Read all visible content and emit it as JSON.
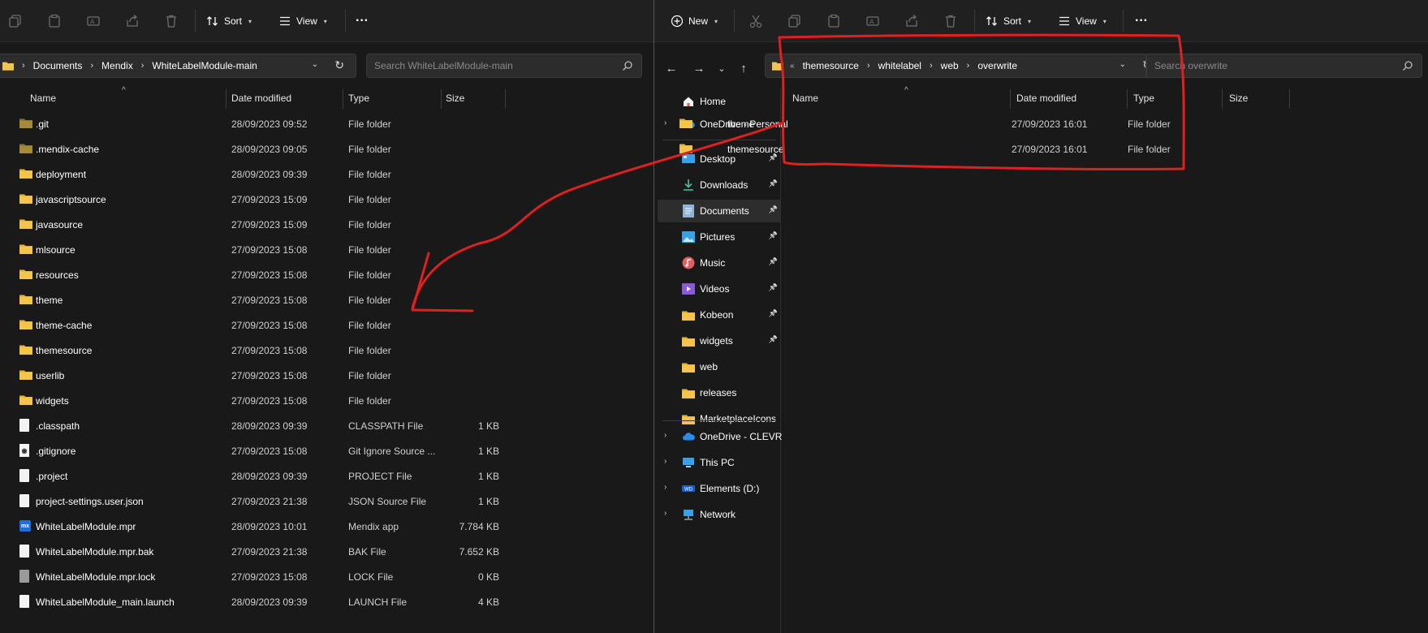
{
  "left": {
    "toolbar": {
      "sort_label": "Sort",
      "view_label": "View",
      "more_label": "···"
    },
    "breadcrumb": [
      "Documents",
      "Mendix",
      "WhiteLabelModule-main"
    ],
    "search_placeholder": "Search WhiteLabelModule-main",
    "columns": {
      "name": "Name",
      "date": "Date modified",
      "type": "Type",
      "size": "Size"
    },
    "files": [
      {
        "name": ".git",
        "date": "28/09/2023 09:52",
        "type": "File folder",
        "size": "",
        "icon": "folder-dark"
      },
      {
        "name": ".mendix-cache",
        "date": "28/09/2023 09:05",
        "type": "File folder",
        "size": "",
        "icon": "folder-dark"
      },
      {
        "name": "deployment",
        "date": "28/09/2023 09:39",
        "type": "File folder",
        "size": "",
        "icon": "folder"
      },
      {
        "name": "javascriptsource",
        "date": "27/09/2023 15:09",
        "type": "File folder",
        "size": "",
        "icon": "folder"
      },
      {
        "name": "javasource",
        "date": "27/09/2023 15:09",
        "type": "File folder",
        "size": "",
        "icon": "folder"
      },
      {
        "name": "mlsource",
        "date": "27/09/2023 15:08",
        "type": "File folder",
        "size": "",
        "icon": "folder"
      },
      {
        "name": "resources",
        "date": "27/09/2023 15:08",
        "type": "File folder",
        "size": "",
        "icon": "folder"
      },
      {
        "name": "theme",
        "date": "27/09/2023 15:08",
        "type": "File folder",
        "size": "",
        "icon": "folder"
      },
      {
        "name": "theme-cache",
        "date": "27/09/2023 15:08",
        "type": "File folder",
        "size": "",
        "icon": "folder"
      },
      {
        "name": "themesource",
        "date": "27/09/2023 15:08",
        "type": "File folder",
        "size": "",
        "icon": "folder"
      },
      {
        "name": "userlib",
        "date": "27/09/2023 15:08",
        "type": "File folder",
        "size": "",
        "icon": "folder"
      },
      {
        "name": "widgets",
        "date": "27/09/2023 15:08",
        "type": "File folder",
        "size": "",
        "icon": "folder"
      },
      {
        "name": ".classpath",
        "date": "28/09/2023 09:39",
        "type": "CLASSPATH File",
        "size": "1 KB",
        "icon": "doc"
      },
      {
        "name": ".gitignore",
        "date": "27/09/2023 15:08",
        "type": "Git Ignore Source ...",
        "size": "1 KB",
        "icon": "git"
      },
      {
        "name": ".project",
        "date": "28/09/2023 09:39",
        "type": "PROJECT File",
        "size": "1 KB",
        "icon": "doc"
      },
      {
        "name": "project-settings.user.json",
        "date": "27/09/2023 21:38",
        "type": "JSON Source File",
        "size": "1 KB",
        "icon": "doc"
      },
      {
        "name": "WhiteLabelModule.mpr",
        "date": "28/09/2023 10:01",
        "type": "Mendix app",
        "size": "7.784 KB",
        "icon": "mx"
      },
      {
        "name": "WhiteLabelModule.mpr.bak",
        "date": "27/09/2023 21:38",
        "type": "BAK File",
        "size": "7.652 KB",
        "icon": "doc"
      },
      {
        "name": "WhiteLabelModule.mpr.lock",
        "date": "27/09/2023 15:08",
        "type": "LOCK File",
        "size": "0 KB",
        "icon": "doc-gray"
      },
      {
        "name": "WhiteLabelModule_main.launch",
        "date": "28/09/2023 09:39",
        "type": "LAUNCH File",
        "size": "4 KB",
        "icon": "doc"
      }
    ]
  },
  "right": {
    "toolbar": {
      "new_label": "New",
      "sort_label": "Sort",
      "view_label": "View",
      "more_label": "···"
    },
    "breadcrumb_overflow": "«",
    "breadcrumb": [
      "themesource",
      "whitelabel",
      "web",
      "overwrite"
    ],
    "search_placeholder": "Search overwrite",
    "columns": {
      "name": "Name",
      "date": "Date modified",
      "type": "Type",
      "size": "Size"
    },
    "files": [
      {
        "name": "theme",
        "date": "27/09/2023 16:01",
        "type": "File folder",
        "icon": "folder"
      },
      {
        "name": "themesource",
        "date": "27/09/2023 16:01",
        "type": "File folder",
        "icon": "folder"
      }
    ],
    "nav": {
      "home": "Home",
      "onedrive_personal": "OneDrive - Personal",
      "quick_access": [
        {
          "label": "Desktop",
          "icon": "desktop-icon",
          "pinned": true
        },
        {
          "label": "Downloads",
          "icon": "downloads-icon",
          "pinned": true
        },
        {
          "label": "Documents",
          "icon": "documents-icon",
          "pinned": true,
          "selected": true
        },
        {
          "label": "Pictures",
          "icon": "pictures-icon",
          "pinned": true
        },
        {
          "label": "Music",
          "icon": "music-icon",
          "pinned": true
        },
        {
          "label": "Videos",
          "icon": "videos-icon",
          "pinned": true
        },
        {
          "label": "Kobeon",
          "icon": "folder-icon",
          "pinned": true
        },
        {
          "label": "widgets",
          "icon": "folder-icon",
          "pinned": true
        },
        {
          "label": "web",
          "icon": "folder-icon",
          "pinned": false
        },
        {
          "label": "releases",
          "icon": "folder-icon",
          "pinned": false
        },
        {
          "label": "MarketplaceIcons",
          "icon": "folder-icon",
          "pinned": false
        }
      ],
      "onedrive_clevr": "OneDrive - CLEVR",
      "this_pc": "This PC",
      "elements_drive": "Elements (D:)",
      "network": "Network"
    }
  },
  "colors": {
    "background": "#191919",
    "toolbar": "#202020",
    "folder": "#f4c54b",
    "annotation": "#e02020"
  }
}
